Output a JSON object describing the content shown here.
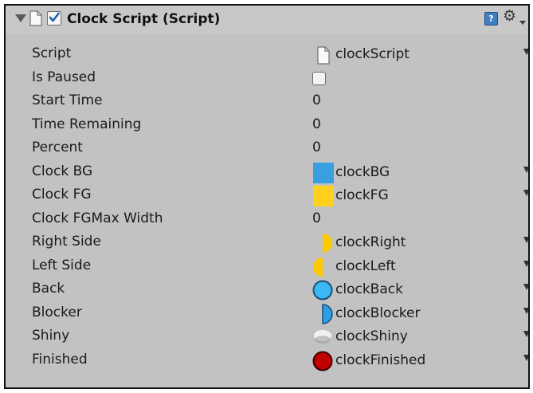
{
  "component": {
    "title": "Clock Script (Script)",
    "enabled": true,
    "help_icon": "book-help-icon",
    "settings_icon": "gear-icon",
    "foldout_icon": "foldout-arrow-icon"
  },
  "fields": {
    "script": {
      "label": "Script",
      "value": "clockScript"
    },
    "is_paused": {
      "label": "Is Paused",
      "checked": false
    },
    "start_time": {
      "label": "Start Time",
      "value": "0"
    },
    "time_remaining": {
      "label": "Time Remaining",
      "value": "0"
    },
    "percent": {
      "label": "Percent",
      "value": "0"
    },
    "clock_bg": {
      "label": "Clock BG",
      "value": "clockBG",
      "thumb_color": "#3a9fe0"
    },
    "clock_fg": {
      "label": "Clock FG",
      "value": "clockFG",
      "thumb_color": "#ffd11e"
    },
    "clock_fgmax": {
      "label": "Clock FGMax Width",
      "value": "0"
    },
    "right_side": {
      "label": "Right Side",
      "value": "clockRight",
      "thumb_color": "#ffc900"
    },
    "left_side": {
      "label": "Left Side",
      "value": "clockLeft",
      "thumb_color": "#ffc900"
    },
    "back": {
      "label": "Back",
      "value": "clockBack",
      "thumb_color": "#3bb7f2"
    },
    "blocker": {
      "label": "Blocker",
      "value": "clockBlocker",
      "thumb_color": "#2e9ee6"
    },
    "shiny": {
      "label": "Shiny",
      "value": "clockShiny",
      "thumb_color": "#f2f2f2"
    },
    "finished": {
      "label": "Finished",
      "value": "clockFinished",
      "thumb_color": "#c00000"
    }
  }
}
